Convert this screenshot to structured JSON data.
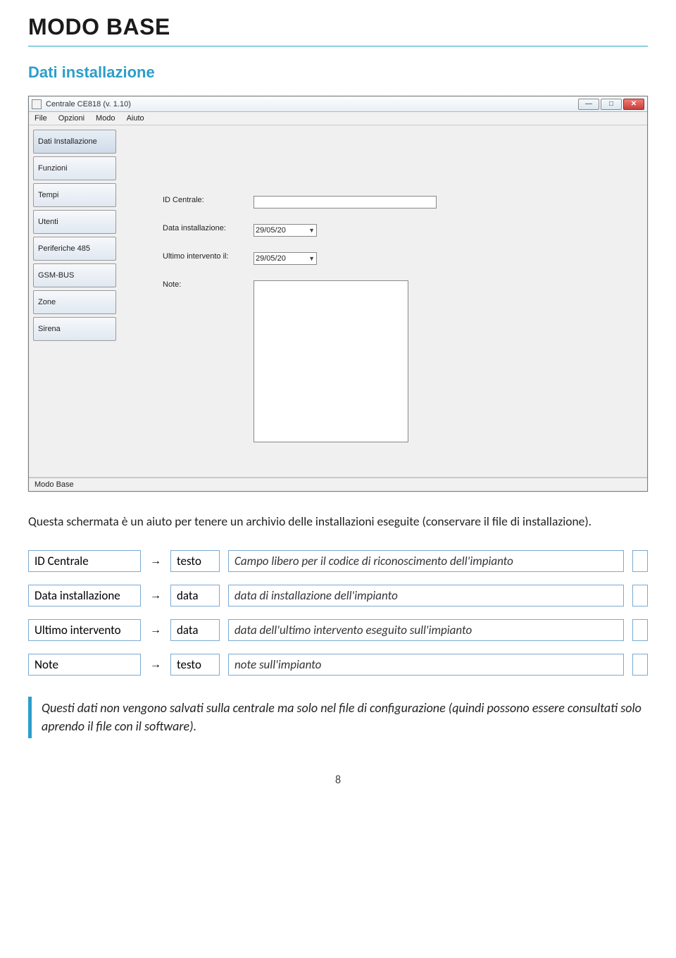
{
  "page": {
    "title": "MODO BASE",
    "section": "Dati installazione",
    "number": "8"
  },
  "app": {
    "title": "Centrale CE818 (v. 1.10)",
    "menubar": [
      "File",
      "Opzioni",
      "Modo",
      "Aiuto"
    ],
    "sidebar": [
      "Dati Installazione",
      "Funzioni",
      "Tempi",
      "Utenti",
      "Periferiche 485",
      "GSM-BUS",
      "Zone",
      "Sirena"
    ],
    "form": {
      "id_label": "ID Centrale:",
      "install_label": "Data installazione:",
      "last_label": "Ultimo intervento il:",
      "note_label": "Note:",
      "date_value": "29/05/20"
    },
    "status": "Modo Base"
  },
  "intro": "Questa schermata è un aiuto per tenere un archivio delle installazioni eseguite (conservare il file di installazione).",
  "params": [
    {
      "name": "ID Centrale",
      "arrow": "→",
      "type": "testo",
      "desc": "Campo libero per il codice di riconoscimento dell'impianto"
    },
    {
      "name": "Data installazione",
      "arrow": "→",
      "type": "data",
      "desc": "data di installazione dell'impianto"
    },
    {
      "name": "Ultimo intervento",
      "arrow": "→",
      "type": "data",
      "desc": "data dell'ultimo intervento eseguito sull'impianto"
    },
    {
      "name": "Note",
      "arrow": "→",
      "type": "testo",
      "desc": "note sull'impianto"
    }
  ],
  "callout": "Questi dati non vengono salvati sulla centrale ma solo nel file di configurazione (quindi possono essere consultati solo aprendo il file con il software)."
}
